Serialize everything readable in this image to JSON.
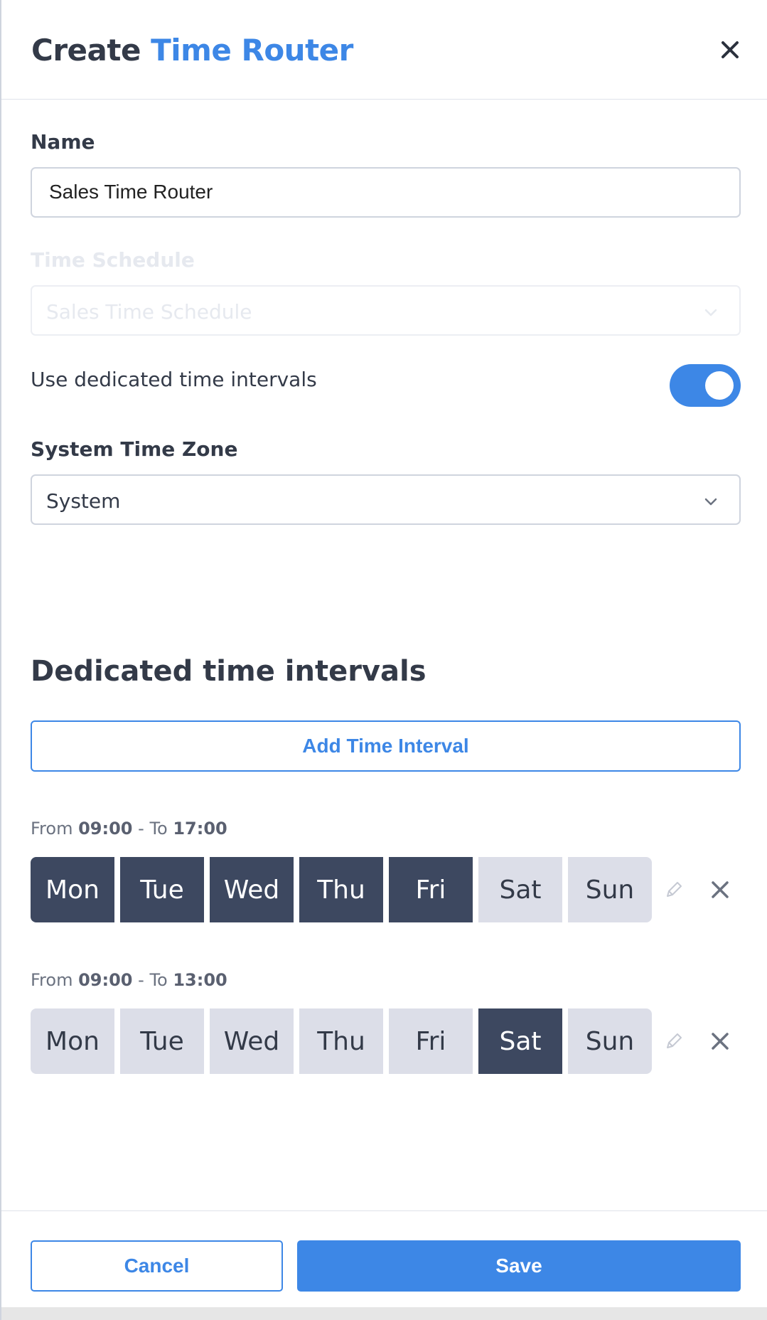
{
  "header": {
    "title_prefix": "Create",
    "title_accent": "Time Router",
    "close_icon": "close-icon"
  },
  "form": {
    "name": {
      "label": "Name",
      "value": "Sales Time Router"
    },
    "time_schedule": {
      "label": "Time Schedule",
      "value": "Sales Time Schedule",
      "disabled": true
    },
    "dedicated_toggle": {
      "label": "Use dedicated time intervals",
      "on": true
    },
    "time_zone": {
      "label": "System Time Zone",
      "value": "System"
    }
  },
  "intervals_section": {
    "title": "Dedicated time intervals",
    "add_button": "Add Time Interval",
    "from_word": "From",
    "to_word": "- To",
    "intervals": [
      {
        "from": "09:00",
        "to": "17:00",
        "days": [
          {
            "label": "Mon",
            "active": true
          },
          {
            "label": "Tue",
            "active": true
          },
          {
            "label": "Wed",
            "active": true
          },
          {
            "label": "Thu",
            "active": true
          },
          {
            "label": "Fri",
            "active": true
          },
          {
            "label": "Sat",
            "active": false
          },
          {
            "label": "Sun",
            "active": false
          }
        ]
      },
      {
        "from": "09:00",
        "to": "13:00",
        "days": [
          {
            "label": "Mon",
            "active": false
          },
          {
            "label": "Tue",
            "active": false
          },
          {
            "label": "Wed",
            "active": false
          },
          {
            "label": "Thu",
            "active": false
          },
          {
            "label": "Fri",
            "active": false
          },
          {
            "label": "Sat",
            "active": true
          },
          {
            "label": "Sun",
            "active": false
          }
        ]
      }
    ]
  },
  "footer": {
    "cancel": "Cancel",
    "save": "Save"
  },
  "colors": {
    "accent": "#3d87e6",
    "day_active": "#3d4860",
    "day_inactive": "#dcdee8",
    "text": "#333a48"
  },
  "icons": {
    "edit": "pencil-icon",
    "remove": "close-icon",
    "dropdown": "chevron-down-icon"
  }
}
